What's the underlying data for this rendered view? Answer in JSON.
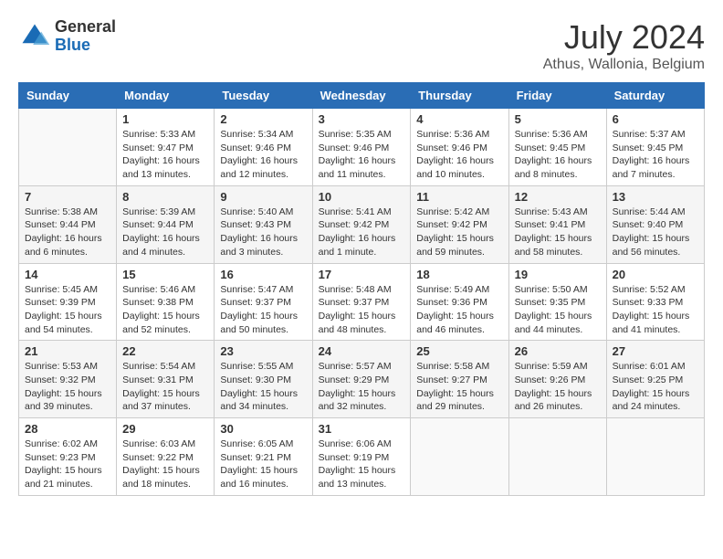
{
  "header": {
    "logo_general": "General",
    "logo_blue": "Blue",
    "month_year": "July 2024",
    "location": "Athus, Wallonia, Belgium"
  },
  "weekdays": [
    "Sunday",
    "Monday",
    "Tuesday",
    "Wednesday",
    "Thursday",
    "Friday",
    "Saturday"
  ],
  "weeks": [
    [
      {
        "day": "",
        "sunrise": "",
        "sunset": "",
        "daylight": ""
      },
      {
        "day": "1",
        "sunrise": "5:33 AM",
        "sunset": "9:47 PM",
        "daylight": "16 hours and 13 minutes."
      },
      {
        "day": "2",
        "sunrise": "5:34 AM",
        "sunset": "9:46 PM",
        "daylight": "16 hours and 12 minutes."
      },
      {
        "day": "3",
        "sunrise": "5:35 AM",
        "sunset": "9:46 PM",
        "daylight": "16 hours and 11 minutes."
      },
      {
        "day": "4",
        "sunrise": "5:36 AM",
        "sunset": "9:46 PM",
        "daylight": "16 hours and 10 minutes."
      },
      {
        "day": "5",
        "sunrise": "5:36 AM",
        "sunset": "9:45 PM",
        "daylight": "16 hours and 8 minutes."
      },
      {
        "day": "6",
        "sunrise": "5:37 AM",
        "sunset": "9:45 PM",
        "daylight": "16 hours and 7 minutes."
      }
    ],
    [
      {
        "day": "7",
        "sunrise": "5:38 AM",
        "sunset": "9:44 PM",
        "daylight": "16 hours and 6 minutes."
      },
      {
        "day": "8",
        "sunrise": "5:39 AM",
        "sunset": "9:44 PM",
        "daylight": "16 hours and 4 minutes."
      },
      {
        "day": "9",
        "sunrise": "5:40 AM",
        "sunset": "9:43 PM",
        "daylight": "16 hours and 3 minutes."
      },
      {
        "day": "10",
        "sunrise": "5:41 AM",
        "sunset": "9:42 PM",
        "daylight": "16 hours and 1 minute."
      },
      {
        "day": "11",
        "sunrise": "5:42 AM",
        "sunset": "9:42 PM",
        "daylight": "15 hours and 59 minutes."
      },
      {
        "day": "12",
        "sunrise": "5:43 AM",
        "sunset": "9:41 PM",
        "daylight": "15 hours and 58 minutes."
      },
      {
        "day": "13",
        "sunrise": "5:44 AM",
        "sunset": "9:40 PM",
        "daylight": "15 hours and 56 minutes."
      }
    ],
    [
      {
        "day": "14",
        "sunrise": "5:45 AM",
        "sunset": "9:39 PM",
        "daylight": "15 hours and 54 minutes."
      },
      {
        "day": "15",
        "sunrise": "5:46 AM",
        "sunset": "9:38 PM",
        "daylight": "15 hours and 52 minutes."
      },
      {
        "day": "16",
        "sunrise": "5:47 AM",
        "sunset": "9:37 PM",
        "daylight": "15 hours and 50 minutes."
      },
      {
        "day": "17",
        "sunrise": "5:48 AM",
        "sunset": "9:37 PM",
        "daylight": "15 hours and 48 minutes."
      },
      {
        "day": "18",
        "sunrise": "5:49 AM",
        "sunset": "9:36 PM",
        "daylight": "15 hours and 46 minutes."
      },
      {
        "day": "19",
        "sunrise": "5:50 AM",
        "sunset": "9:35 PM",
        "daylight": "15 hours and 44 minutes."
      },
      {
        "day": "20",
        "sunrise": "5:52 AM",
        "sunset": "9:33 PM",
        "daylight": "15 hours and 41 minutes."
      }
    ],
    [
      {
        "day": "21",
        "sunrise": "5:53 AM",
        "sunset": "9:32 PM",
        "daylight": "15 hours and 39 minutes."
      },
      {
        "day": "22",
        "sunrise": "5:54 AM",
        "sunset": "9:31 PM",
        "daylight": "15 hours and 37 minutes."
      },
      {
        "day": "23",
        "sunrise": "5:55 AM",
        "sunset": "9:30 PM",
        "daylight": "15 hours and 34 minutes."
      },
      {
        "day": "24",
        "sunrise": "5:57 AM",
        "sunset": "9:29 PM",
        "daylight": "15 hours and 32 minutes."
      },
      {
        "day": "25",
        "sunrise": "5:58 AM",
        "sunset": "9:27 PM",
        "daylight": "15 hours and 29 minutes."
      },
      {
        "day": "26",
        "sunrise": "5:59 AM",
        "sunset": "9:26 PM",
        "daylight": "15 hours and 26 minutes."
      },
      {
        "day": "27",
        "sunrise": "6:01 AM",
        "sunset": "9:25 PM",
        "daylight": "15 hours and 24 minutes."
      }
    ],
    [
      {
        "day": "28",
        "sunrise": "6:02 AM",
        "sunset": "9:23 PM",
        "daylight": "15 hours and 21 minutes."
      },
      {
        "day": "29",
        "sunrise": "6:03 AM",
        "sunset": "9:22 PM",
        "daylight": "15 hours and 18 minutes."
      },
      {
        "day": "30",
        "sunrise": "6:05 AM",
        "sunset": "9:21 PM",
        "daylight": "15 hours and 16 minutes."
      },
      {
        "day": "31",
        "sunrise": "6:06 AM",
        "sunset": "9:19 PM",
        "daylight": "15 hours and 13 minutes."
      },
      {
        "day": "",
        "sunrise": "",
        "sunset": "",
        "daylight": ""
      },
      {
        "day": "",
        "sunrise": "",
        "sunset": "",
        "daylight": ""
      },
      {
        "day": "",
        "sunrise": "",
        "sunset": "",
        "daylight": ""
      }
    ]
  ],
  "labels": {
    "sunrise_prefix": "Sunrise: ",
    "sunset_prefix": "Sunset: ",
    "daylight_prefix": "Daylight: "
  }
}
